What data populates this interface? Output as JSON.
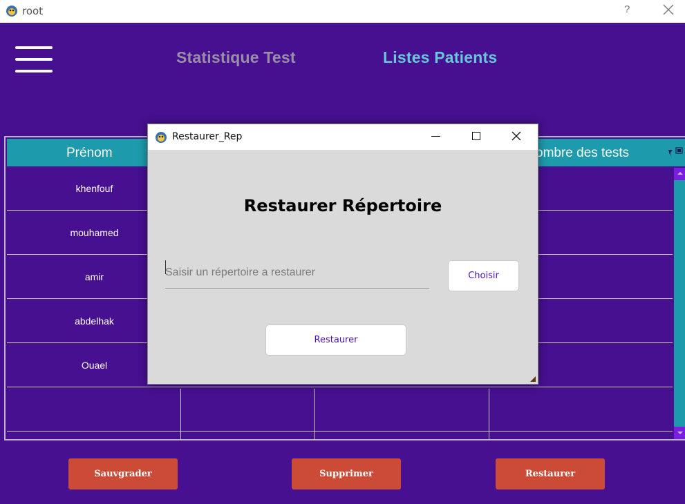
{
  "window": {
    "title": "root",
    "help_label": "?"
  },
  "header": {
    "nav": [
      {
        "label": "Statistique Test"
      },
      {
        "label": "Listes Patients"
      }
    ]
  },
  "table": {
    "columns": [
      "Prénom",
      "ombre des tests"
    ],
    "rows": [
      {
        "prenom": "khenfouf"
      },
      {
        "prenom": "mouhamed"
      },
      {
        "prenom": "amir"
      },
      {
        "prenom": "abdelhak"
      },
      {
        "prenom": "Ouael"
      },
      {
        "prenom": ""
      }
    ]
  },
  "actions": {
    "save_label": "Sauvgrader",
    "delete_label": "Supprimer",
    "restore_label": "Restaurer"
  },
  "dialog": {
    "title": "Restaurer_Rep",
    "heading": "Restaurer Répertoire",
    "input_placeholder": "Saisir un répertoire a restaurer",
    "input_value": "",
    "choose_label": "Choisir",
    "restore_label": "Restaurer"
  },
  "colors": {
    "background": "#461090",
    "table_header": "#1d9aab",
    "action_button": "#cc4b36",
    "nav_active": "#68c7d8",
    "nav_inactive": "#9b8fa7",
    "dialog_button_text": "#4a12b0"
  },
  "icons": {
    "app": "python-feather-icon",
    "menu": "hamburger-menu-icon",
    "close": "close-icon",
    "minimize": "minimize-icon",
    "maximize": "maximize-icon"
  }
}
